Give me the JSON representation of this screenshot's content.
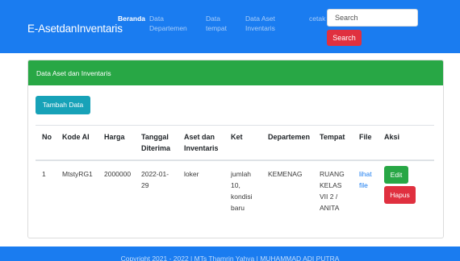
{
  "navbar": {
    "brand": "E-AsetdanInventaris",
    "links": [
      "Beranda",
      "Data Departemen",
      "Data tempat",
      "Data Aset Inventaris",
      "cetak"
    ],
    "search_placeholder": "Search",
    "search_button": "Search"
  },
  "card": {
    "title": "Data Aset dan Inventaris",
    "add_button": "Tambah Data",
    "columns": [
      "No",
      "Kode AI",
      "Harga",
      "Tanggal Diterima",
      "Aset dan Inventaris",
      "Ket",
      "Departemen",
      "Tempat",
      "File",
      "Aksi"
    ],
    "rows": [
      {
        "no": "1",
        "kode": "MtstyRG1",
        "harga": "2000000",
        "tanggal": "2022-01-29",
        "aset": "loker",
        "ket": "jumlah 10, kondisi baru",
        "departemen": "KEMENAG",
        "tempat": "RUANG KELAS VII 2 / ANITA",
        "file": "lihat file",
        "edit": "Edit",
        "hapus": "Hapus"
      }
    ]
  },
  "footer": {
    "text": "Copyright 2021 - 2022 | MTs Thamrin Yahya | MUHAMMAD ADI PUTRA"
  },
  "colors": {
    "primary": "#1a7cf0",
    "success": "#28a745",
    "danger": "#e0303f",
    "info": "#17a2b8"
  }
}
